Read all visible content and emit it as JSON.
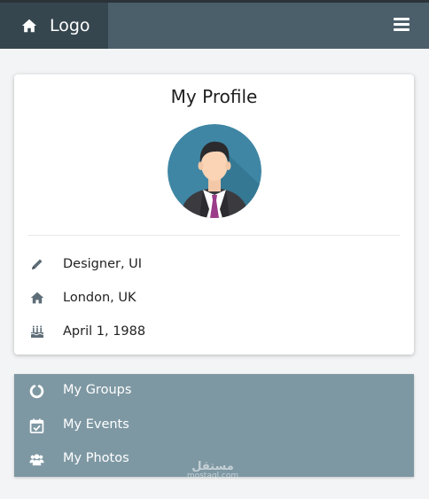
{
  "header": {
    "logo_label": "Logo",
    "home_icon": "home-icon",
    "menu_icon": "hamburger-menu-icon"
  },
  "profile": {
    "title": "My Profile",
    "avatar": "businessman-avatar",
    "details": [
      {
        "icon": "pencil-icon",
        "text": "Designer, UI"
      },
      {
        "icon": "home-icon",
        "text": "London, UK"
      },
      {
        "icon": "birthday-cake-icon",
        "text": "April 1, 1988"
      }
    ]
  },
  "nav": {
    "items": [
      {
        "icon": "circle-notch-icon",
        "label": "My Groups"
      },
      {
        "icon": "calendar-check-icon",
        "label": "My Events"
      },
      {
        "icon": "users-icon",
        "label": "My Photos"
      }
    ]
  },
  "watermark": {
    "arabic": "مستقل",
    "latin": "mostaql.com"
  },
  "colors": {
    "topbar": "#4b5f6b",
    "brand": "#36464f",
    "nav_bg": "#7e98a3",
    "icon_gray": "#5d6d77",
    "page_bg": "#f3f4f5"
  }
}
